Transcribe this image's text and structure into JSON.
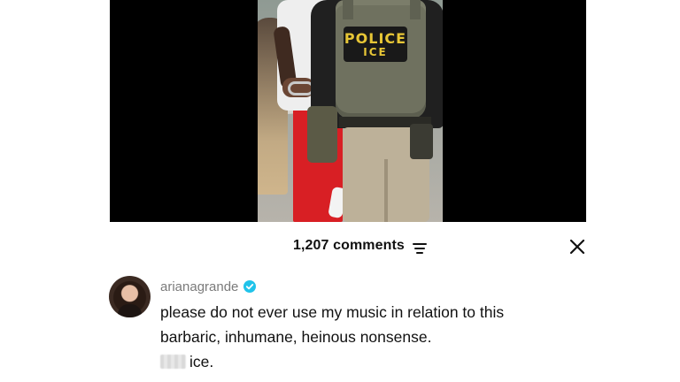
{
  "video": {
    "vest_patch_line1": "POLICE",
    "vest_patch_line2": "ICE",
    "background_color": "#000000",
    "patch_text_color": "#e7c636",
    "detainee_pants_color": "#d81f24"
  },
  "comments_sheet": {
    "count_label": "1,207 comments",
    "filter_icon": "filter-lines-icon",
    "close_icon": "close-x-icon"
  },
  "comment": {
    "username": "arianagrande",
    "verified_badge_color": "#20c3ea",
    "text_line1": "please do not ever use my music in relation to this",
    "text_line2": "barbaric, inhumane, heinous nonsense.",
    "text_line3_visible": "ice.",
    "text_line3_redacted": true
  }
}
